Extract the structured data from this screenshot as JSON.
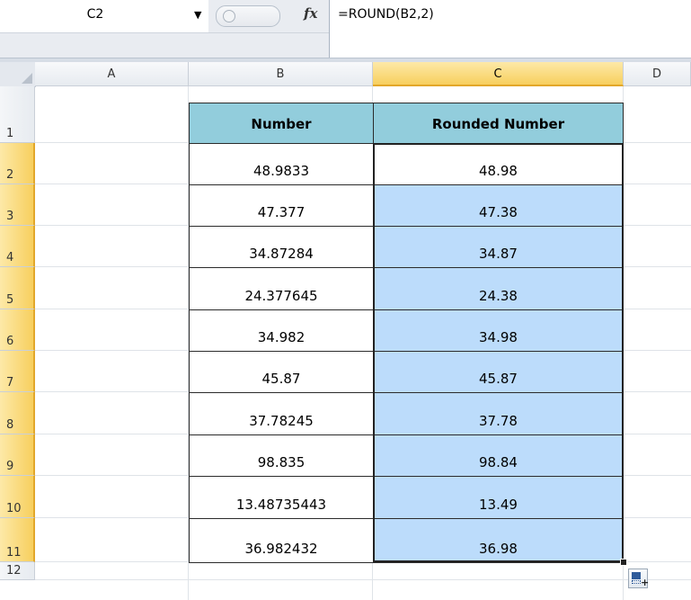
{
  "formula_bar": {
    "name_box": "C2",
    "fx_icon": "fx-icon",
    "formula": "=ROUND(B2,2)"
  },
  "columns": [
    "A",
    "B",
    "C",
    "D"
  ],
  "rows": [
    "1",
    "2",
    "3",
    "4",
    "5",
    "6",
    "7",
    "8",
    "9",
    "10",
    "11",
    "12"
  ],
  "table": {
    "headers": [
      "Number",
      "Rounded Number"
    ],
    "numbers": [
      "48.9833",
      "47.377",
      "34.87284",
      "24.377645",
      "34.982",
      "45.87",
      "37.78245",
      "98.835",
      "13.48735443",
      "36.982432"
    ],
    "rounded": [
      "48.98",
      "47.38",
      "34.87",
      "24.38",
      "34.98",
      "45.87",
      "37.78",
      "98.84",
      "13.49",
      "36.98"
    ]
  },
  "selection": {
    "column": "C",
    "rows": "2-11",
    "active_cell": "C2"
  },
  "colors": {
    "header_fill": "#92cddc",
    "selection_fill": "#bcdcfb",
    "selected_header": "#f7cf5e"
  }
}
